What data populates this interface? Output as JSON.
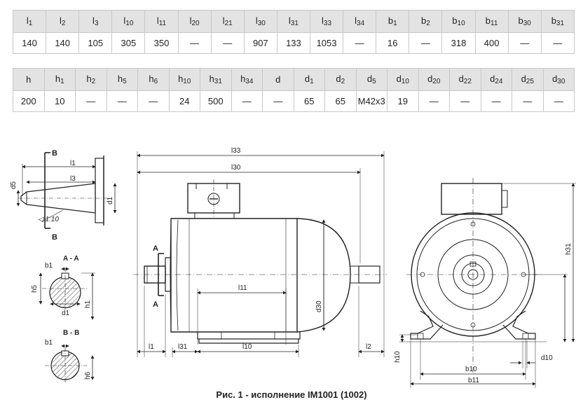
{
  "table1": {
    "headers": [
      {
        "base": "l",
        "sub": "1"
      },
      {
        "base": "l",
        "sub": "2"
      },
      {
        "base": "l",
        "sub": "3"
      },
      {
        "base": "l",
        "sub": "10"
      },
      {
        "base": "l",
        "sub": "11"
      },
      {
        "base": "l",
        "sub": "20"
      },
      {
        "base": "l",
        "sub": "21"
      },
      {
        "base": "l",
        "sub": "30"
      },
      {
        "base": "l",
        "sub": "31"
      },
      {
        "base": "l",
        "sub": "33"
      },
      {
        "base": "l",
        "sub": "34"
      },
      {
        "base": "b",
        "sub": "1"
      },
      {
        "base": "b",
        "sub": "2"
      },
      {
        "base": "b",
        "sub": "10"
      },
      {
        "base": "b",
        "sub": "11"
      },
      {
        "base": "b",
        "sub": "30"
      },
      {
        "base": "b",
        "sub": "31"
      }
    ],
    "values": [
      "140",
      "140",
      "105",
      "305",
      "350",
      "—",
      "—",
      "907",
      "133",
      "1053",
      "—",
      "16",
      "—",
      "318",
      "400",
      "—",
      "—"
    ]
  },
  "table2": {
    "headers": [
      {
        "base": "h",
        "sub": ""
      },
      {
        "base": "h",
        "sub": "1"
      },
      {
        "base": "h",
        "sub": "2"
      },
      {
        "base": "h",
        "sub": "5"
      },
      {
        "base": "h",
        "sub": "6"
      },
      {
        "base": "h",
        "sub": "10"
      },
      {
        "base": "h",
        "sub": "31"
      },
      {
        "base": "h",
        "sub": "34"
      },
      {
        "base": "d",
        "sub": ""
      },
      {
        "base": "d",
        "sub": "1"
      },
      {
        "base": "d",
        "sub": "2"
      },
      {
        "base": "d",
        "sub": "5"
      },
      {
        "base": "d",
        "sub": "10"
      },
      {
        "base": "d",
        "sub": "20"
      },
      {
        "base": "d",
        "sub": "22"
      },
      {
        "base": "d",
        "sub": "24"
      },
      {
        "base": "d",
        "sub": "25"
      },
      {
        "base": "d",
        "sub": "30"
      }
    ],
    "values": [
      "200",
      "10",
      "—",
      "—",
      "—",
      "24",
      "500",
      "—",
      "—",
      "65",
      "65",
      "M42x3",
      "19",
      "—",
      "—",
      "—",
      "—",
      "—"
    ]
  },
  "drawing_labels": {
    "shaft_section_mark": "B",
    "l1": "l1",
    "l3": "l3",
    "d5": "d5",
    "d1": "d1",
    "taper": "1:10",
    "aa_title": "A - A",
    "b1": "b1",
    "h5": "h5",
    "h1": "h1",
    "bb_title": "B - B",
    "h6": "h6",
    "l33": "l33",
    "l30": "l30",
    "l11": "l11",
    "d30": "d30",
    "a_mark": "A",
    "l31": "l31",
    "l10": "l10",
    "l2": "l2",
    "h31": "h31",
    "h10": "h10",
    "b10": "b10",
    "b11": "b11",
    "d10": "d10"
  },
  "caption": "Рис. 1 - исполнение IM1001 (1002)"
}
